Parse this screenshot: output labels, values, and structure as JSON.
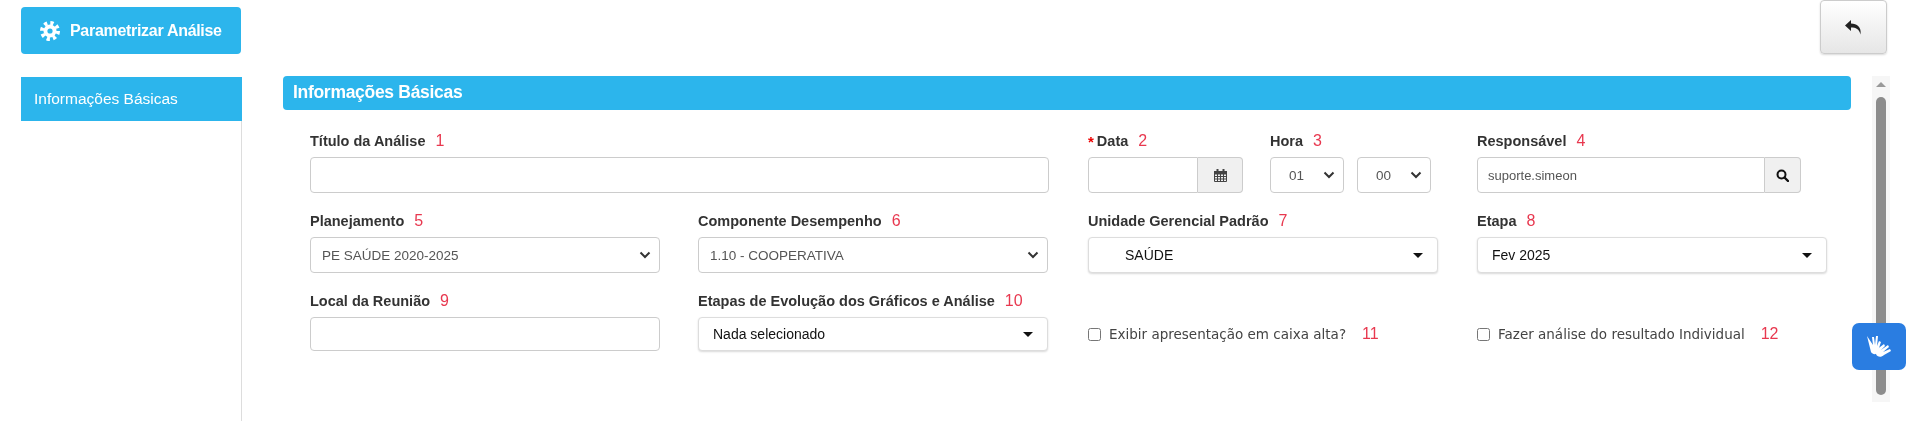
{
  "toolbar": {
    "primary_button": {
      "label": "Parametrizar Análise"
    }
  },
  "sidebar": {
    "items": [
      {
        "label": "Informações Básicas",
        "selected": true
      }
    ]
  },
  "section": {
    "title": "Informações Básicas",
    "fields": [
      {
        "kind": "text",
        "label": "Título da Análise",
        "marker": "1"
      },
      {
        "kind": "date",
        "label": "Data",
        "required_mark": "*",
        "marker": "2"
      },
      {
        "kind": "time",
        "label": "Hora",
        "marker": "3",
        "parts": [
          "01",
          "00"
        ]
      },
      {
        "kind": "lookup",
        "label": "Responsável",
        "marker": "4",
        "value": "suporte.simeon"
      },
      {
        "kind": "select",
        "label": "Planejamento",
        "marker": "5",
        "value": "PE SAÚDE 2020-2025"
      },
      {
        "kind": "select",
        "label": "Componente Desempenho",
        "marker": "6",
        "value": "1.10 - COOPERATIVA"
      },
      {
        "kind": "dropdown",
        "label": "Unidade Gerencial Padrão",
        "marker": "7",
        "value": "SAÚDE",
        "indented": true
      },
      {
        "kind": "dropdown",
        "label": "Etapa",
        "marker": "8",
        "value": "Fev 2025"
      },
      {
        "kind": "text",
        "label": "Local da Reunião",
        "marker": "9"
      },
      {
        "kind": "dropdown",
        "label": "Etapas de Evolução dos Gráficos e Análise",
        "marker": "10",
        "value": "Nada selecionado"
      },
      {
        "kind": "checkbox",
        "label": "Exibir apresentação em caixa alta?",
        "marker": "11",
        "checked": false
      },
      {
        "kind": "checkbox",
        "label": "Fazer análise do resultado Individual",
        "marker": "12",
        "checked": false
      }
    ]
  }
}
